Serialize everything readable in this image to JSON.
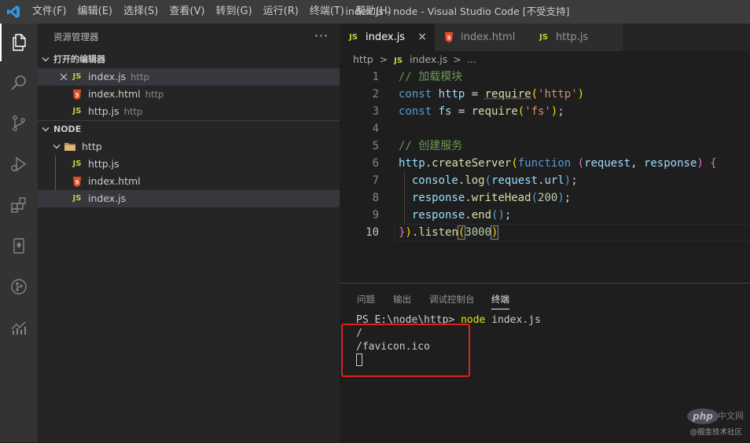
{
  "titlebar": {
    "window_title": "index.js - node - Visual Studio Code [不受支持]",
    "menu": [
      "文件(F)",
      "编辑(E)",
      "选择(S)",
      "查看(V)",
      "转到(G)",
      "运行(R)",
      "终端(T)",
      "帮助(H)"
    ]
  },
  "activitybar": {
    "icons": [
      "explorer-icon",
      "search-icon",
      "source-control-icon",
      "run-debug-icon",
      "extensions-icon",
      "book-icon",
      "git-graph-icon",
      "analytics-icon"
    ]
  },
  "sidebar": {
    "title": "资源管理器",
    "more": "···",
    "open_editors": {
      "header": "打开的编辑器",
      "items": [
        {
          "type": "JS",
          "name": "index.js",
          "desc": "http"
        },
        {
          "type": "5",
          "name": "index.html",
          "desc": "http"
        },
        {
          "type": "JS",
          "name": "http.js",
          "desc": "http"
        }
      ]
    },
    "workspace": {
      "header": "NODE",
      "folder": "http",
      "files": [
        {
          "type": "JS",
          "name": "http.js"
        },
        {
          "type": "5",
          "name": "index.html"
        },
        {
          "type": "JS",
          "name": "index.js"
        }
      ]
    }
  },
  "tabs": [
    {
      "type": "JS",
      "label": "index.js",
      "close": "×"
    },
    {
      "type": "5",
      "label": "index.html"
    },
    {
      "type": "JS",
      "label": "http.js"
    }
  ],
  "breadcrumb": {
    "folder": "http",
    "sep": ">",
    "file_type": "JS",
    "file": "index.js",
    "ellipsis": "..."
  },
  "editor": {
    "line_numbers": [
      "1",
      "2",
      "3",
      "4",
      "5",
      "6",
      "7",
      "8",
      "9",
      "10"
    ],
    "code": {
      "l1_comment": "// 加载模块",
      "kw_const": "const",
      "v_http": "http",
      "v_fs": "fs",
      "eq": " = ",
      "fn_require": "require",
      "s_http": "'http'",
      "s_fs": "'fs'",
      "l5_comment": "// 创建服务",
      "fn_createServer": "createServer",
      "kw_function": "function",
      "p_request": "request",
      "p_response": "response",
      "v_console": "console",
      "fn_log": "log",
      "v_url": "url",
      "fn_writeHead": "writeHead",
      "n_200": "200",
      "fn_end": "end",
      "fn_listen": "listen",
      "n_3000": "3000"
    }
  },
  "panel": {
    "tabs": [
      "问题",
      "输出",
      "调试控制台",
      "终端"
    ],
    "terminal": {
      "prompt": "PS E:\\node\\http> ",
      "command": "node",
      "args": " index.js",
      "output": [
        "/",
        "/favicon.ico"
      ]
    }
  },
  "watermark": {
    "logo": "php",
    "cn": "中文网",
    "credit": "@掘金技术社区"
  },
  "colors": {
    "js_badge": "#cbcb41",
    "html_badge": "#e44d26",
    "highlight_box": "#e02020",
    "accent": "#007acc"
  }
}
